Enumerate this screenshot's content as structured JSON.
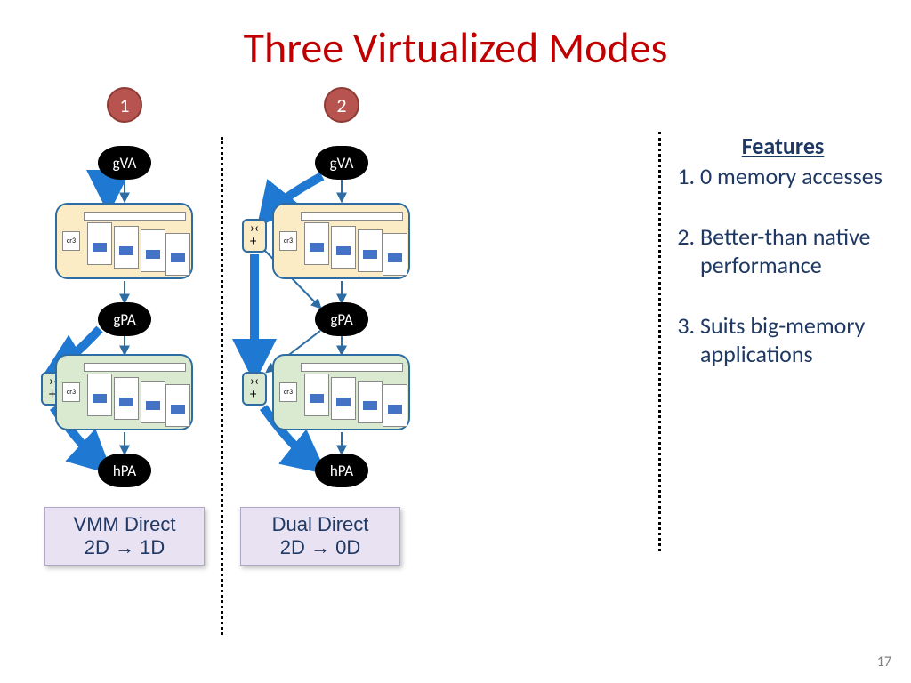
{
  "title": "Three Virtualized Modes",
  "page_number": "17",
  "badges": {
    "one": "1",
    "two": "2"
  },
  "nodes": {
    "gva": "gVA",
    "gpa": "gPA",
    "hpa": "hPA",
    "cr3": "cr3",
    "bypass_glyph": "›‹\n+"
  },
  "captions": {
    "mode1_line1": "VMM Direct",
    "mode1_line2": "2D → 1D",
    "mode2_line1": "Dual Direct",
    "mode2_line2": "2D → 0D"
  },
  "features": {
    "heading": "Features",
    "items": [
      "0 memory accesses",
      "Better-than native performance",
      "Suits big-memory applications"
    ]
  }
}
